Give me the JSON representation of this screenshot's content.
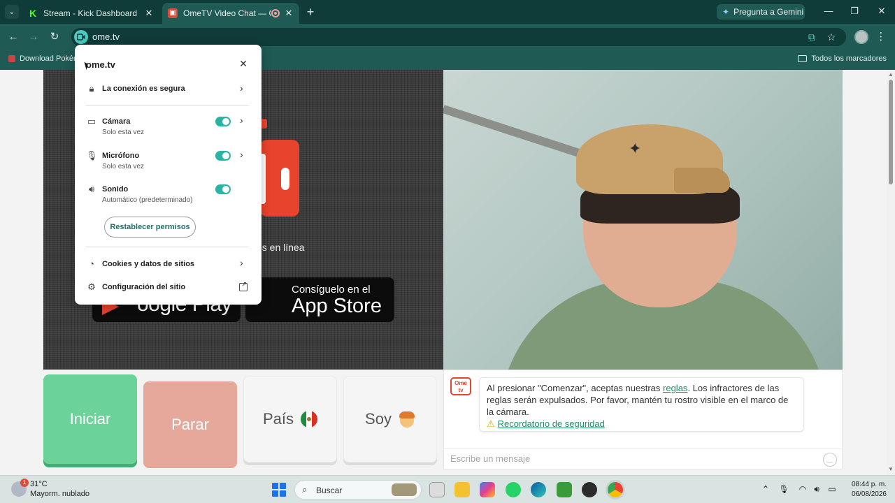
{
  "browser": {
    "tabs": [
      {
        "title": "Stream - Kick Dashboard",
        "favicon": "kick-logo-icon"
      },
      {
        "title": "OmeTV Video Chat — Ome",
        "favicon": "ometv-logo-icon"
      }
    ],
    "new_tab_icon": "plus-icon",
    "gemini_label": "Pregunta a Gemini",
    "url": "ome.tv",
    "bookmark_left": "Download Pokém",
    "bookmark_right": "Todos los marcadores",
    "accent": "#1f5a54"
  },
  "popup": {
    "host": "ome.tv",
    "secure_label": "La conexión es segura",
    "permissions": [
      {
        "label": "Cámara",
        "sub": "Solo esta vez",
        "enabled": true
      },
      {
        "label": "Micrófono",
        "sub": "Solo esta vez",
        "enabled": true
      },
      {
        "label": "Sonido",
        "sub": "Automático (predeterminado)",
        "enabled": true
      }
    ],
    "reset_label": "Restablecer permisos",
    "cookies_label": "Cookies y datos de sitios",
    "settings_label": "Configuración del sitio"
  },
  "page": {
    "users_online_partial": "os en línea",
    "google_play": "oogle Play",
    "app_store_top": "Consíguelo en el",
    "app_store_main": "App Store",
    "buttons": {
      "start": "Iniciar",
      "stop": "Parar",
      "country": "País",
      "gender": "Soy"
    },
    "chat": {
      "logo_text": "Ome tv",
      "message_pre": "Al presionar \"Comenzar\", aceptas nuestras ",
      "message_link": "reglas",
      "message_post": ". Los infractores de las reglas serán expulsados. Por favor, mantén tu rostro visible en el marco de la cámara.",
      "safety_link": "Recordatorio de seguridad",
      "input_placeholder": "Escribe un mensaje"
    },
    "colors": {
      "start": "#6bd39a",
      "stop": "#e6a89a",
      "brand_red": "#e8432d",
      "link": "#1f8f6a"
    }
  },
  "taskbar": {
    "weather_badge": "1",
    "temperature": "31°C",
    "weather_desc": "Mayorm. nublado",
    "search_label": "Buscar",
    "time": "08:44 p. m.",
    "date": "06/08/2026"
  }
}
